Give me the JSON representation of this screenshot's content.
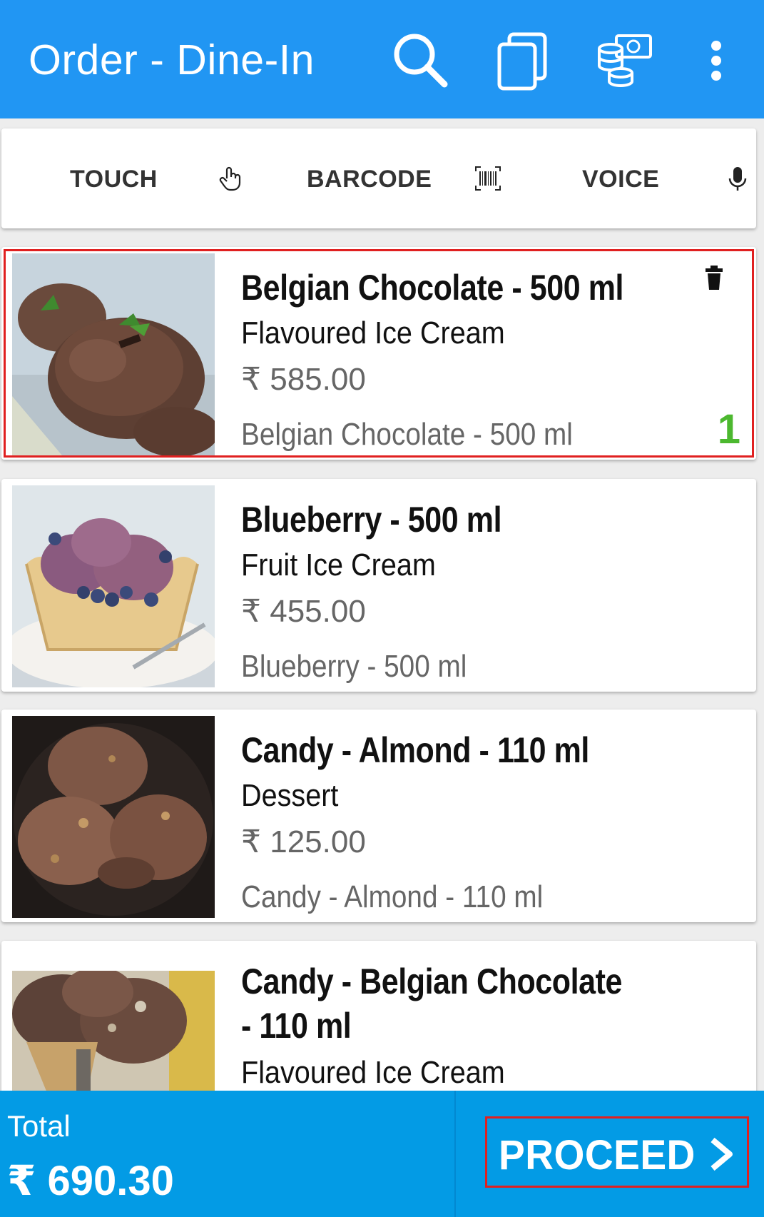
{
  "appbar": {
    "title": "Order - Dine-In",
    "icons": [
      "search-icon",
      "copy-icon",
      "cash-coins-icon",
      "more-vert-icon"
    ],
    "color": "#2196f3"
  },
  "modes": {
    "touch_label": "TOUCH",
    "barcode_label": "BARCODE",
    "voice_label": "VOICE"
  },
  "products": [
    {
      "name": "Belgian Chocolate - 500 ml",
      "category": "Flavoured Ice Cream",
      "price": "₹ 585.00",
      "variant": "Belgian Chocolate - 500 ml",
      "quantity": "1",
      "selected": true
    },
    {
      "name": "Blueberry - 500 ml",
      "category": "Fruit Ice Cream",
      "price": "₹ 455.00",
      "variant": "Blueberry - 500 ml"
    },
    {
      "name": "Candy - Almond - 110 ml",
      "category": "Dessert",
      "price": "₹ 125.00",
      "variant": "Candy - Almond - 110 ml"
    },
    {
      "name": "Candy - Belgian Chocolate - 110 ml",
      "category": "Flavoured Ice Cream"
    }
  ],
  "footer": {
    "total_label": "Total",
    "total_value": "₹ 690.30",
    "proceed_label": "PROCEED",
    "color": "#039be5"
  },
  "colors": {
    "quantity": "#4cb82f",
    "highlight": "#e02020"
  }
}
